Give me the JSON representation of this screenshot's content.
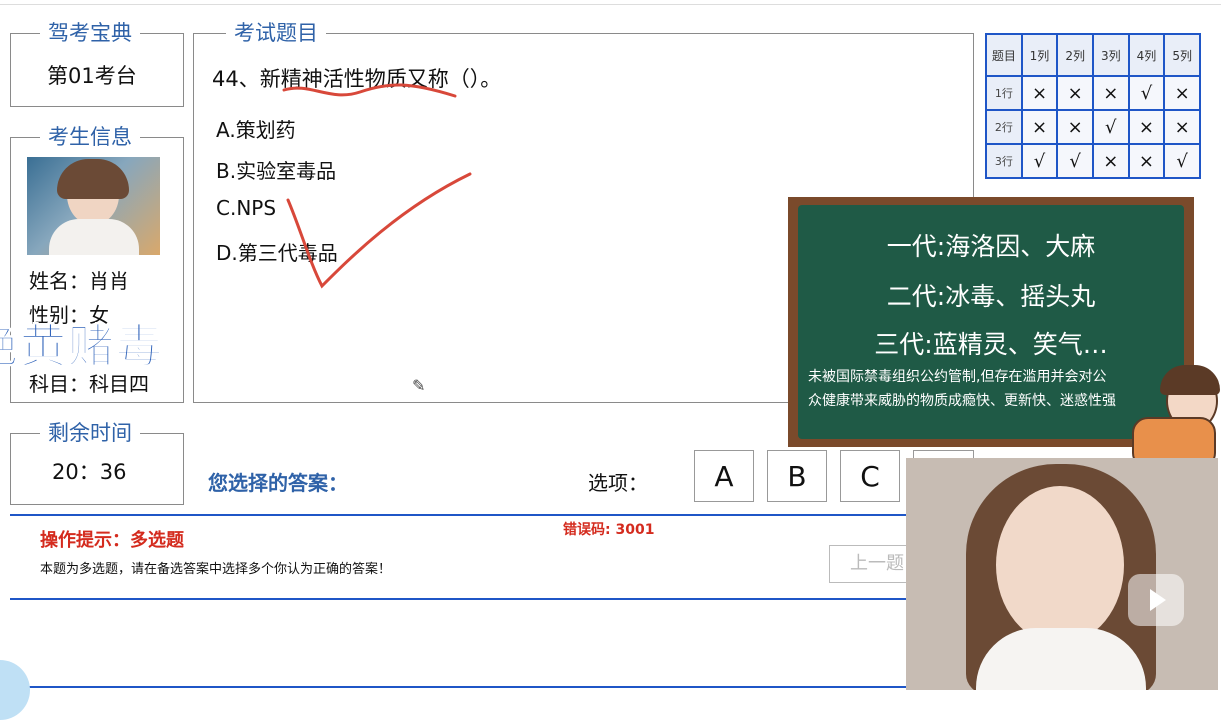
{
  "exam_site": {
    "legend": "驾考宝典",
    "value": "第01考台"
  },
  "question": {
    "legend": "考试题目",
    "text": "44、新精神活性物质又称（）。",
    "options": [
      "A.策划药",
      "B.实验室毒品",
      "C.NPS",
      "D.第三代毒品"
    ]
  },
  "candidate": {
    "legend": "考生信息",
    "name_label": "姓名：",
    "name": "肖肖",
    "gender_label": "性别：",
    "gender": "女",
    "subject_label": "科目：",
    "subject": "科目四",
    "overlay_text": "绝黄赌毒"
  },
  "timer": {
    "legend": "剩余时间",
    "value": "20：36"
  },
  "answer_area": {
    "label": "您选择的答案：",
    "options_label": "选项：",
    "buttons": [
      "A",
      "B",
      "C"
    ]
  },
  "hint": {
    "title": "操作提示：多选题",
    "body": "本题为多选题，请在备选答案中选择多个你认为正确的答案！",
    "error_code": "错误码: 3001",
    "prev_button": "上一题"
  },
  "answer_grid": {
    "header": [
      "题目",
      "1列",
      "2列",
      "3列",
      "4列",
      "5列"
    ],
    "rows": [
      {
        "label": "1行",
        "cells": [
          "×",
          "×",
          "×",
          "√",
          "×"
        ]
      },
      {
        "label": "2行",
        "cells": [
          "×",
          "×",
          "√",
          "×",
          "×"
        ]
      },
      {
        "label": "3行",
        "cells": [
          "√",
          "√",
          "×",
          "×",
          "√"
        ]
      }
    ]
  },
  "blackboard": {
    "lines": [
      "一代:海洛因、大麻",
      "二代:冰毒、摇头丸",
      "三代:蓝精灵、笑气…"
    ],
    "note_lines": [
      "未被国际禁毒组织公约管制,但存在滥用并会对公",
      "众健康带来威胁的物质成瘾快、更新快、迷惑性强"
    ]
  },
  "colors": {
    "accent": "#2f62a8",
    "grid_border": "#1f56c7",
    "hint_red": "#d42b1e",
    "annotation": "#d8483a",
    "board_green": "#1f5a46"
  }
}
